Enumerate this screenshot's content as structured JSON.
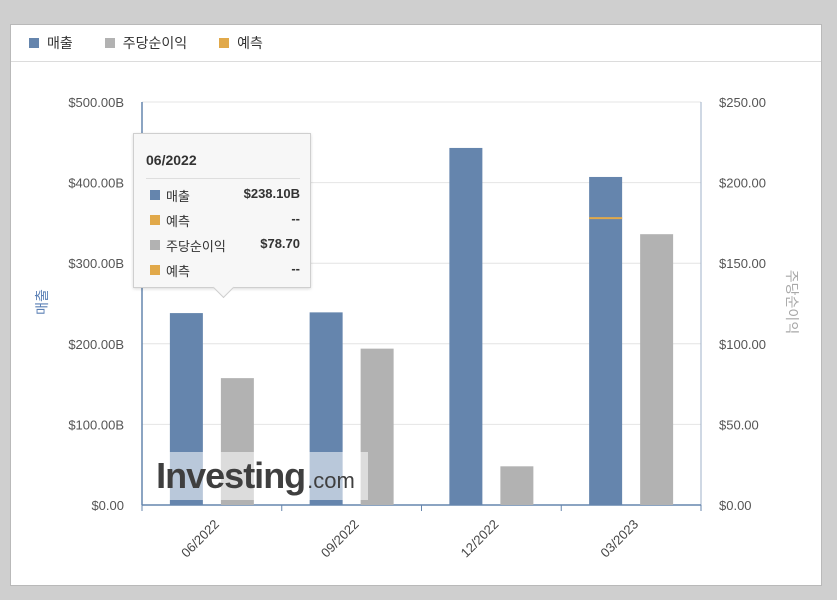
{
  "legend": [
    {
      "label": "매출",
      "color": "#6585ad"
    },
    {
      "label": "주당순이익",
      "color": "#b2b2b2"
    },
    {
      "label": "예측",
      "color": "#e1a94a"
    }
  ],
  "chart_data": {
    "type": "bar",
    "categories": [
      "06/2022",
      "09/2022",
      "12/2022",
      "03/2023"
    ],
    "series": [
      {
        "name": "매출",
        "axis": "left",
        "color": "#6585ad",
        "values": [
          238.1,
          239.0,
          443.0,
          407.0
        ]
      },
      {
        "name": "주당순이익",
        "axis": "right",
        "color": "#b2b2b2",
        "values": [
          78.7,
          97.0,
          24.0,
          168.0
        ]
      },
      {
        "name": "예측",
        "axis": "left",
        "color": "#e1a94a",
        "values": [
          null,
          null,
          null,
          356.0
        ]
      }
    ],
    "y_left": {
      "label": "매출",
      "range": [
        0,
        500
      ],
      "ticks": [
        "$0.00",
        "$100.00B",
        "$200.00B",
        "$300.00B",
        "$400.00B",
        "$500.00B"
      ]
    },
    "y_right": {
      "label": "주당순이익",
      "range": [
        0,
        250
      ],
      "ticks": [
        "$0.00",
        "$50.00",
        "$100.00",
        "$150.00",
        "$200.00",
        "$250.00"
      ]
    },
    "grid": true
  },
  "tooltip": {
    "title": "06/2022",
    "rows": [
      {
        "label": "매출",
        "value": "$238.10B",
        "color": "#6585ad"
      },
      {
        "label": "예측",
        "value": "--",
        "color": "#e1a94a"
      },
      {
        "label": "주당순이익",
        "value": "$78.70",
        "color": "#b2b2b2"
      },
      {
        "label": "예측",
        "value": "--",
        "color": "#e1a94a"
      }
    ]
  },
  "watermark": {
    "brand": "Investing",
    "suffix": ".com"
  }
}
